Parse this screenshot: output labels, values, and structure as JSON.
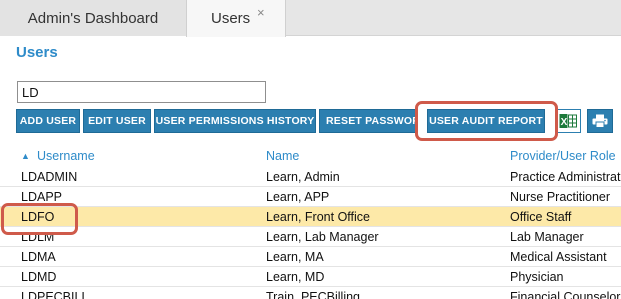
{
  "tabs": [
    {
      "label": "Admin's Dashboard"
    },
    {
      "label": "Users",
      "close": "×"
    }
  ],
  "page_title": "Users",
  "search": {
    "value": "LD"
  },
  "toolbar": {
    "add_user": "ADD USER",
    "edit_user": "EDIT USER",
    "permissions_history": "USER PERMISSIONS HISTORY",
    "reset_password": "RESET PASSWORD",
    "audit_report": "USER AUDIT REPORT",
    "excel_icon": "excel-icon",
    "print_icon": "printer-icon"
  },
  "table": {
    "sort_indicator": "▲",
    "columns": [
      "Username",
      "Name",
      "Provider/User Role"
    ],
    "rows": [
      {
        "username": "LDADMIN",
        "name": "Learn, Admin",
        "role": "Practice Administrator"
      },
      {
        "username": "LDAPP",
        "name": "Learn, APP",
        "role": "Nurse Practitioner"
      },
      {
        "username": "LDFO",
        "name": "Learn, Front Office",
        "role": "Office Staff"
      },
      {
        "username": "LDLM",
        "name": "Learn, Lab Manager",
        "role": "Lab Manager"
      },
      {
        "username": "LDMA",
        "name": "Learn, MA",
        "role": "Medical Assistant"
      },
      {
        "username": "LDMD",
        "name": "Learn, MD",
        "role": "Physician"
      },
      {
        "username": "LDPECBILL",
        "name": "Train, PECBilling",
        "role": "Financial Counselor"
      }
    ]
  },
  "colors": {
    "accent": "#2e8bc9",
    "button": "#2c7fb0",
    "selected_row": "#fde9a8",
    "highlight": "#cf5a4a"
  }
}
